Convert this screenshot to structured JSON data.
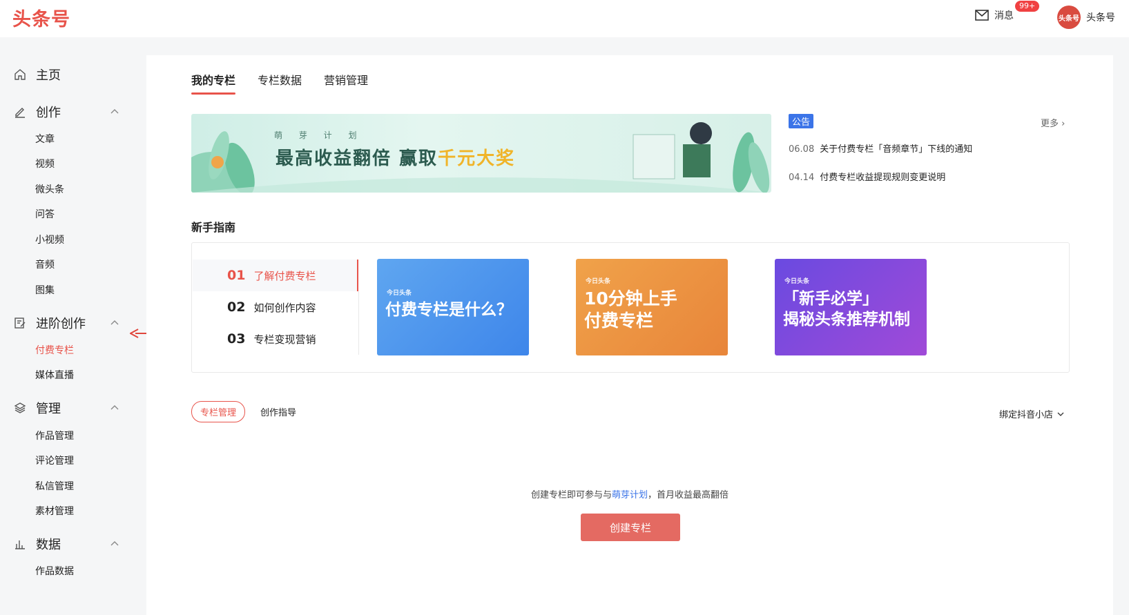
{
  "header": {
    "logo": "头条号",
    "messages_label": "消息",
    "messages_count": "99+",
    "avatar_text": "头条号",
    "username": "头条号"
  },
  "sidebar": {
    "home": "主页",
    "create": {
      "label": "创作",
      "items": [
        "文章",
        "视频",
        "微头条",
        "问答",
        "小视频",
        "音频",
        "图集"
      ]
    },
    "advanced": {
      "label": "进阶创作",
      "items": [
        "付费专栏",
        "媒体直播"
      ],
      "active_item": "付费专栏"
    },
    "manage": {
      "label": "管理",
      "items": [
        "作品管理",
        "评论管理",
        "私信管理",
        "素材管理"
      ]
    },
    "data": {
      "label": "数据",
      "items": [
        "作品数据"
      ]
    }
  },
  "tabs": [
    "我的专栏",
    "专栏数据",
    "营销管理"
  ],
  "banner": {
    "subtitle": "萌 芽 计 划",
    "headline": "最高收益翻倍 赢取",
    "headline_highlight": "千元大奖"
  },
  "notice": {
    "badge": "公告",
    "more": "更多",
    "items": [
      {
        "date": "06.08",
        "text": "关于付费专栏「音频章节」下线的通知"
      },
      {
        "date": "04.14",
        "text": "付费专栏收益提现规则变更说明"
      }
    ]
  },
  "guide": {
    "title": "新手指南",
    "items": [
      {
        "num": "01",
        "label": "了解付费专栏"
      },
      {
        "num": "02",
        "label": "如何创作内容"
      },
      {
        "num": "03",
        "label": "专栏变现营销"
      }
    ],
    "cards": [
      {
        "brand": "今日头条",
        "title": "付费专栏是什么？"
      },
      {
        "brand": "今日头条",
        "title_line1": "10分钟上手",
        "title_line2": "付费专栏"
      },
      {
        "brand": "今日头条",
        "title_line1": "「新手必学」",
        "title_line2": "揭秘头条推荐机制"
      }
    ]
  },
  "subtabs": {
    "active": "专栏管理",
    "other": "创作指导"
  },
  "bind_shop": "绑定抖音小店",
  "empty": {
    "prefix": "创建专栏即可参与与",
    "link": "萌芽计划",
    "suffix": "，首月收益最高翻倍"
  },
  "create_button": "创建专栏",
  "colors": {
    "accent": "#e8534a",
    "link": "#3b74e8",
    "button": "#e46a62"
  }
}
